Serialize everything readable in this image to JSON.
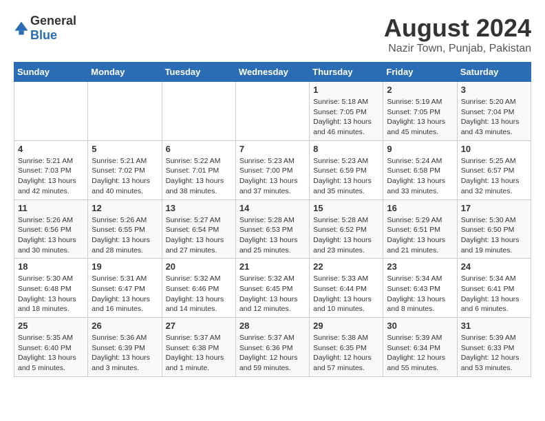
{
  "header": {
    "logo_general": "General",
    "logo_blue": "Blue",
    "title": "August 2024",
    "subtitle": "Nazir Town, Punjab, Pakistan"
  },
  "weekdays": [
    "Sunday",
    "Monday",
    "Tuesday",
    "Wednesday",
    "Thursday",
    "Friday",
    "Saturday"
  ],
  "weeks": [
    [
      {
        "day": "",
        "info": ""
      },
      {
        "day": "",
        "info": ""
      },
      {
        "day": "",
        "info": ""
      },
      {
        "day": "",
        "info": ""
      },
      {
        "day": "1",
        "info": "Sunrise: 5:18 AM\nSunset: 7:05 PM\nDaylight: 13 hours\nand 46 minutes."
      },
      {
        "day": "2",
        "info": "Sunrise: 5:19 AM\nSunset: 7:05 PM\nDaylight: 13 hours\nand 45 minutes."
      },
      {
        "day": "3",
        "info": "Sunrise: 5:20 AM\nSunset: 7:04 PM\nDaylight: 13 hours\nand 43 minutes."
      }
    ],
    [
      {
        "day": "4",
        "info": "Sunrise: 5:21 AM\nSunset: 7:03 PM\nDaylight: 13 hours\nand 42 minutes."
      },
      {
        "day": "5",
        "info": "Sunrise: 5:21 AM\nSunset: 7:02 PM\nDaylight: 13 hours\nand 40 minutes."
      },
      {
        "day": "6",
        "info": "Sunrise: 5:22 AM\nSunset: 7:01 PM\nDaylight: 13 hours\nand 38 minutes."
      },
      {
        "day": "7",
        "info": "Sunrise: 5:23 AM\nSunset: 7:00 PM\nDaylight: 13 hours\nand 37 minutes."
      },
      {
        "day": "8",
        "info": "Sunrise: 5:23 AM\nSunset: 6:59 PM\nDaylight: 13 hours\nand 35 minutes."
      },
      {
        "day": "9",
        "info": "Sunrise: 5:24 AM\nSunset: 6:58 PM\nDaylight: 13 hours\nand 33 minutes."
      },
      {
        "day": "10",
        "info": "Sunrise: 5:25 AM\nSunset: 6:57 PM\nDaylight: 13 hours\nand 32 minutes."
      }
    ],
    [
      {
        "day": "11",
        "info": "Sunrise: 5:26 AM\nSunset: 6:56 PM\nDaylight: 13 hours\nand 30 minutes."
      },
      {
        "day": "12",
        "info": "Sunrise: 5:26 AM\nSunset: 6:55 PM\nDaylight: 13 hours\nand 28 minutes."
      },
      {
        "day": "13",
        "info": "Sunrise: 5:27 AM\nSunset: 6:54 PM\nDaylight: 13 hours\nand 27 minutes."
      },
      {
        "day": "14",
        "info": "Sunrise: 5:28 AM\nSunset: 6:53 PM\nDaylight: 13 hours\nand 25 minutes."
      },
      {
        "day": "15",
        "info": "Sunrise: 5:28 AM\nSunset: 6:52 PM\nDaylight: 13 hours\nand 23 minutes."
      },
      {
        "day": "16",
        "info": "Sunrise: 5:29 AM\nSunset: 6:51 PM\nDaylight: 13 hours\nand 21 minutes."
      },
      {
        "day": "17",
        "info": "Sunrise: 5:30 AM\nSunset: 6:50 PM\nDaylight: 13 hours\nand 19 minutes."
      }
    ],
    [
      {
        "day": "18",
        "info": "Sunrise: 5:30 AM\nSunset: 6:48 PM\nDaylight: 13 hours\nand 18 minutes."
      },
      {
        "day": "19",
        "info": "Sunrise: 5:31 AM\nSunset: 6:47 PM\nDaylight: 13 hours\nand 16 minutes."
      },
      {
        "day": "20",
        "info": "Sunrise: 5:32 AM\nSunset: 6:46 PM\nDaylight: 13 hours\nand 14 minutes."
      },
      {
        "day": "21",
        "info": "Sunrise: 5:32 AM\nSunset: 6:45 PM\nDaylight: 13 hours\nand 12 minutes."
      },
      {
        "day": "22",
        "info": "Sunrise: 5:33 AM\nSunset: 6:44 PM\nDaylight: 13 hours\nand 10 minutes."
      },
      {
        "day": "23",
        "info": "Sunrise: 5:34 AM\nSunset: 6:43 PM\nDaylight: 13 hours\nand 8 minutes."
      },
      {
        "day": "24",
        "info": "Sunrise: 5:34 AM\nSunset: 6:41 PM\nDaylight: 13 hours\nand 6 minutes."
      }
    ],
    [
      {
        "day": "25",
        "info": "Sunrise: 5:35 AM\nSunset: 6:40 PM\nDaylight: 13 hours\nand 5 minutes."
      },
      {
        "day": "26",
        "info": "Sunrise: 5:36 AM\nSunset: 6:39 PM\nDaylight: 13 hours\nand 3 minutes."
      },
      {
        "day": "27",
        "info": "Sunrise: 5:37 AM\nSunset: 6:38 PM\nDaylight: 13 hours\nand 1 minute."
      },
      {
        "day": "28",
        "info": "Sunrise: 5:37 AM\nSunset: 6:36 PM\nDaylight: 12 hours\nand 59 minutes."
      },
      {
        "day": "29",
        "info": "Sunrise: 5:38 AM\nSunset: 6:35 PM\nDaylight: 12 hours\nand 57 minutes."
      },
      {
        "day": "30",
        "info": "Sunrise: 5:39 AM\nSunset: 6:34 PM\nDaylight: 12 hours\nand 55 minutes."
      },
      {
        "day": "31",
        "info": "Sunrise: 5:39 AM\nSunset: 6:33 PM\nDaylight: 12 hours\nand 53 minutes."
      }
    ]
  ]
}
